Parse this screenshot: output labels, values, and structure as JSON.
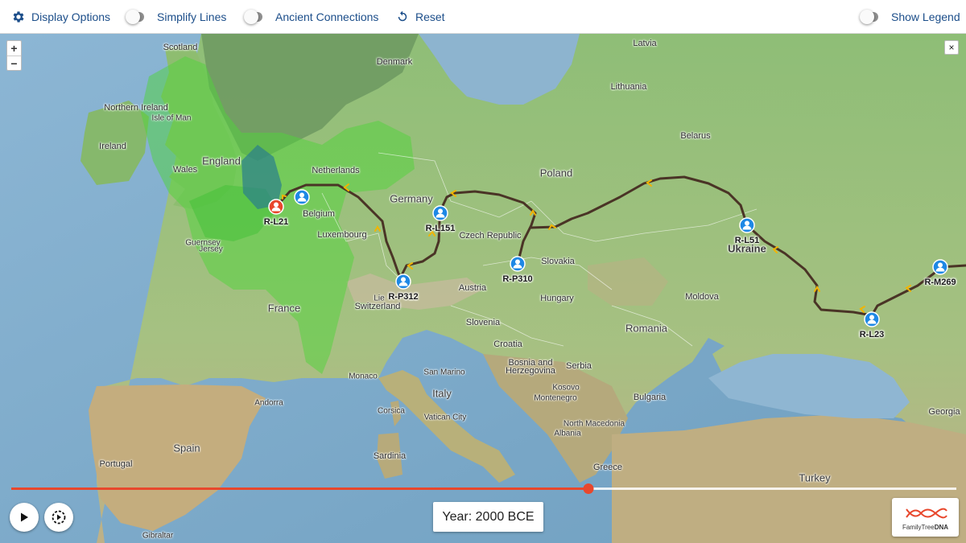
{
  "toolbar": {
    "display_options": "Display Options",
    "simplify_lines": "Simplify Lines",
    "ancient_connections": "Ancient Connections",
    "reset": "Reset",
    "show_legend": "Show Legend"
  },
  "map_controls": {
    "zoom_in": "+",
    "zoom_out": "−",
    "close": "×"
  },
  "places": {
    "scotland": "Scotland",
    "denmark": "Denmark",
    "latvia": "Latvia",
    "lithuania": "Lithuania",
    "northern_ireland": "Northern Ireland",
    "isle_of_man": "Isle of Man",
    "ireland": "Ireland",
    "belarus": "Belarus",
    "england": "England",
    "wales": "Wales",
    "netherlands": "Netherlands",
    "poland": "Poland",
    "germany": "Germany",
    "belgium": "Belgium",
    "luxembourg": "Luxembourg",
    "czech_republic": "Czech Republic",
    "guernsey": "Guernsey",
    "jersey": "Jersey",
    "ukraine": "Ukraine",
    "slovakia": "Slovakia",
    "austria": "Austria",
    "liechtenstein": "Lie",
    "switzerland": "Switzerland",
    "france": "France",
    "hungary": "Hungary",
    "moldova": "Moldova",
    "slovenia": "Slovenia",
    "romania": "Romania",
    "croatia": "Croatia",
    "bosnia1": "Bosnia and",
    "bosnia2": "Herzegovina",
    "serbia": "Serbia",
    "monaco": "Monaco",
    "san_marino": "San Marino",
    "italy": "Italy",
    "kosovo": "Kosovo",
    "bulgaria": "Bulgaria",
    "montenegro": "Montenegro",
    "andorra": "Andorra",
    "corsica": "Corsica",
    "vatican": "Vatican City",
    "north_macedonia": "North Macedonia",
    "albania": "Albania",
    "georgia": "Georgia",
    "spain": "Spain",
    "sardinia": "Sardinia",
    "portugal": "Portugal",
    "greece": "Greece",
    "turkey": "Turkey",
    "gibraltar": "Gibraltar"
  },
  "markers": [
    {
      "id": "R-L21",
      "label": "R-L21",
      "color": "#e8472c"
    },
    {
      "id": "R-P312_pin",
      "label": "",
      "color": "#1e88e5"
    },
    {
      "id": "R-L151",
      "label": "R-L151",
      "color": "#1e88e5"
    },
    {
      "id": "R-P312",
      "label": "R-P312",
      "color": "#1e88e5"
    },
    {
      "id": "R-P310",
      "label": "R-P310",
      "color": "#1e88e5"
    },
    {
      "id": "R-L51",
      "label": "R-L51",
      "color": "#1e88e5"
    },
    {
      "id": "R-M269",
      "label": "R-M269",
      "color": "#1e88e5"
    },
    {
      "id": "R-L23",
      "label": "R-L23",
      "color": "#1e88e5"
    }
  ],
  "timeline": {
    "progress": 0.611,
    "year_label": "Year: 2000 BCE"
  },
  "logo": {
    "part1": "FamilyTree",
    "part2": "DNA"
  },
  "colors": {
    "accent": "#e8472c",
    "toolbar_text": "#1c4e8a",
    "migration_path": "#4a3426",
    "arrow": "#f2b400",
    "heat_light": "#58d646",
    "heat_dark": "#2a7f8c"
  }
}
